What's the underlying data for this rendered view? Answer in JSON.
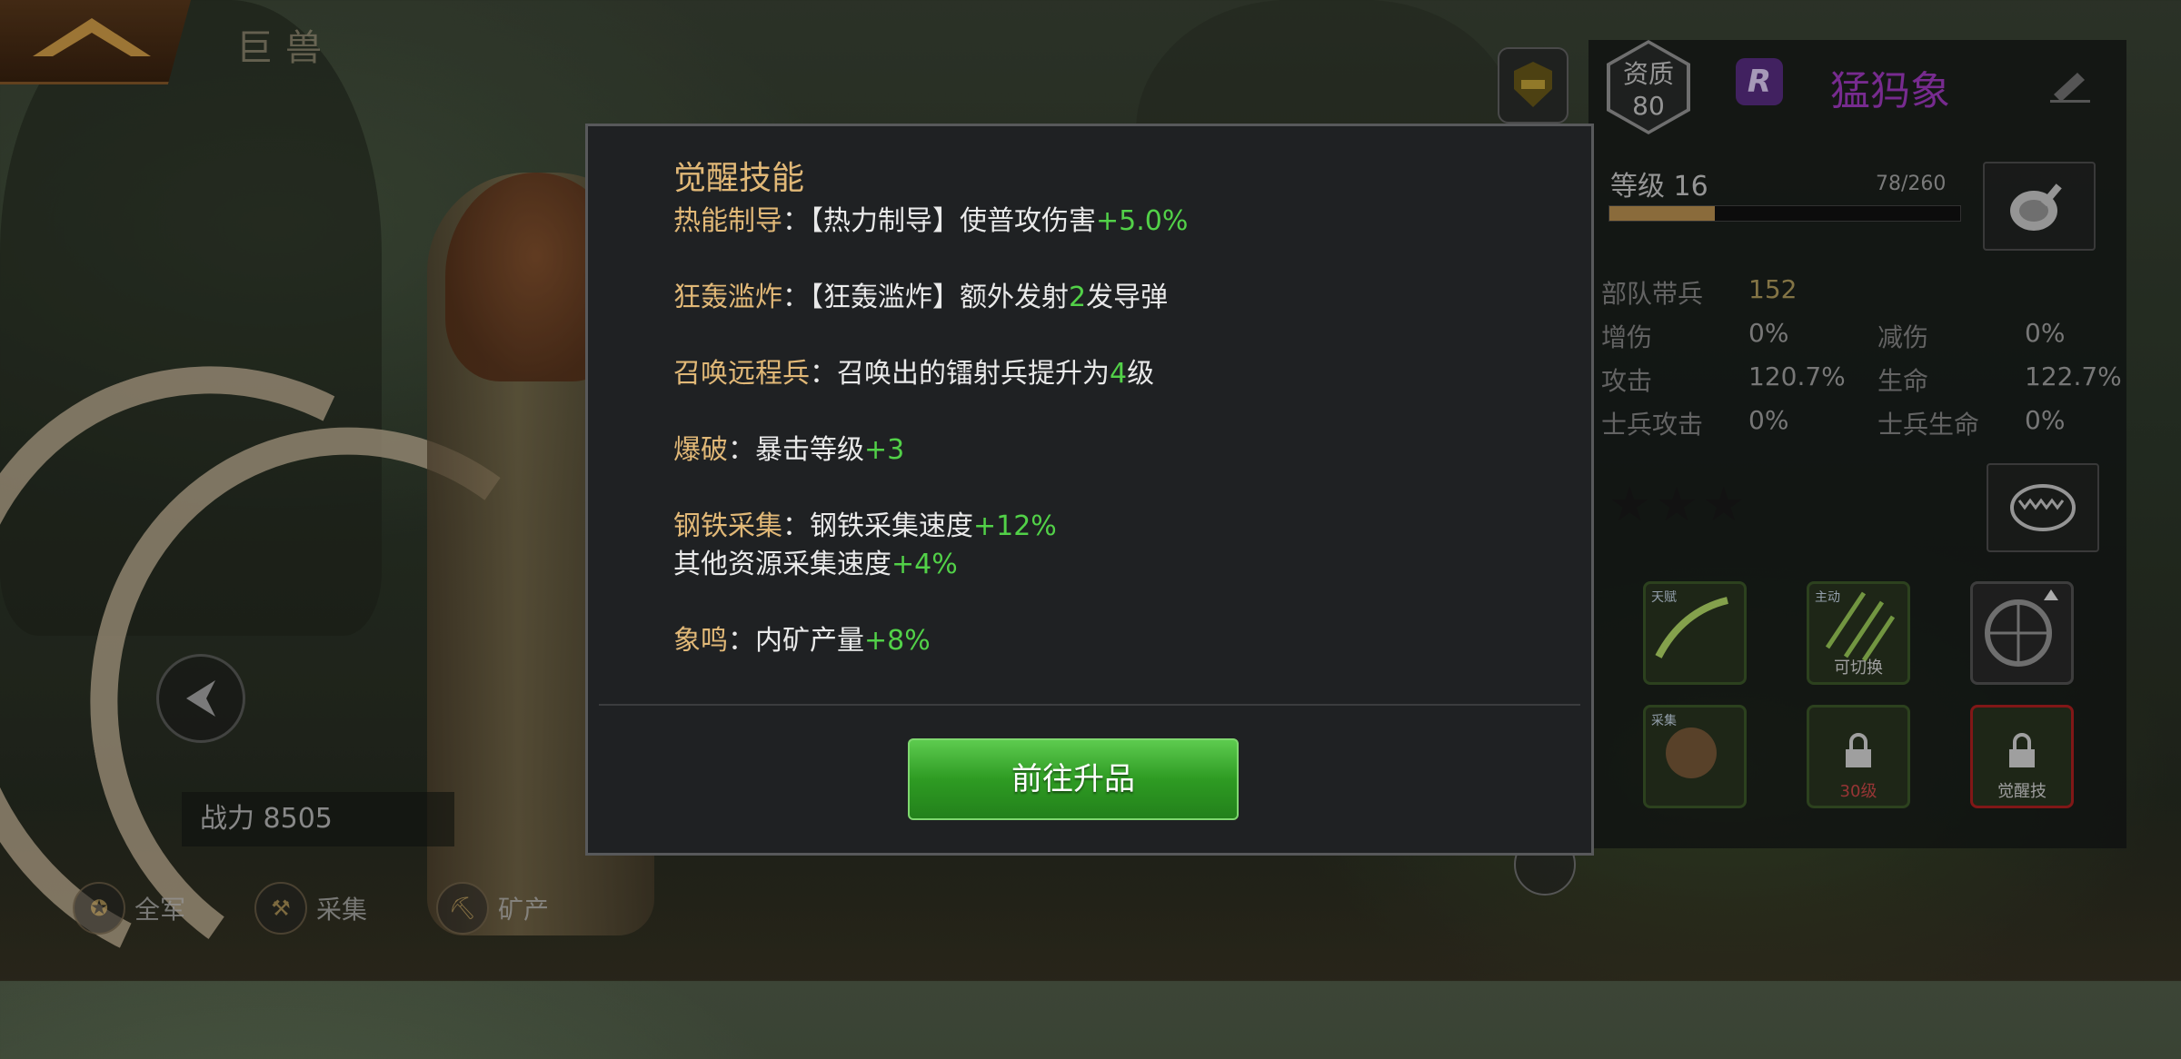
{
  "top_bar": {
    "title": "巨兽"
  },
  "left": {
    "power_label": "战力 8505",
    "bottom_buttons": [
      {
        "label": "全军",
        "icon": "army-icon"
      },
      {
        "label": "采集",
        "icon": "gather-icon"
      },
      {
        "label": "矿产",
        "icon": "mine-icon"
      }
    ]
  },
  "hero": {
    "quality_label": "资质",
    "quality_value": "80",
    "rarity": "R",
    "name": "猛犸象",
    "level_label": "等级 16",
    "exp_text": "78/260",
    "exp_fraction": 0.3,
    "troops_label": "部队带兵",
    "troops_value": "152",
    "stats": [
      {
        "label": "增伤",
        "value": "0%",
        "label2": "减伤",
        "value2": "0%"
      },
      {
        "label": "攻击",
        "value": "120.7%",
        "label2": "生命",
        "value2": "122.7%"
      },
      {
        "label": "士兵攻击",
        "value": "0%",
        "label2": "士兵生命",
        "value2": "0%"
      }
    ],
    "skill_captions": [
      "可切换",
      "30级",
      "觉醒技"
    ],
    "skill_tags": [
      "天赋",
      "主动",
      "采集"
    ]
  },
  "dialog": {
    "title": "觉醒技能",
    "skills": [
      {
        "name": "热能制导",
        "pre": "：【热力制导】使普攻伤害",
        "val": "+5.0%",
        "post": ""
      },
      {
        "name": "狂轰滥炸",
        "pre": "：【狂轰滥炸】额外发射",
        "val": "2",
        "post": "发导弹"
      },
      {
        "name": "召唤远程兵",
        "pre": "：召唤出的镭射兵提升为",
        "val": "4",
        "post": "级"
      },
      {
        "name": "爆破",
        "pre": "：暴击等级",
        "val": "+3",
        "post": ""
      },
      {
        "name": "钢铁采集",
        "pre": "：钢铁采集速度",
        "val": "+12%",
        "post": "",
        "line2_pre": "其他资源采集速度",
        "line2_val": "+4%"
      },
      {
        "name": "象鸣",
        "pre": "：内矿产量",
        "val": "+8%",
        "post": ""
      }
    ],
    "button_label": "前往升品"
  },
  "colors": {
    "accent": "#e1b877",
    "bonus_green": "#52d148",
    "button_green": "#2e9b23",
    "hero_name": "#a53cc7"
  }
}
